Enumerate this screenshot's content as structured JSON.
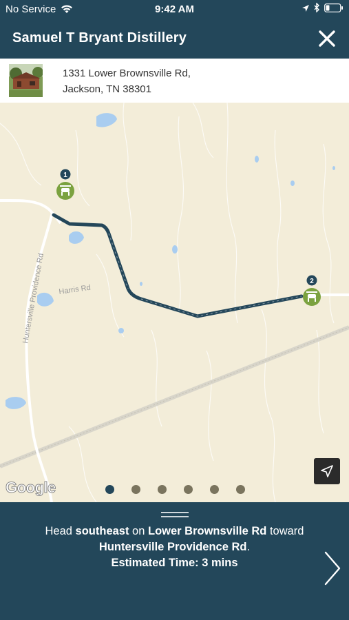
{
  "status": {
    "carrier": "No Service",
    "time": "9:42 AM"
  },
  "header": {
    "title": "Samuel T Bryant Distillery"
  },
  "address": {
    "line1": "1331 Lower Brownsville Rd,",
    "line2": "Jackson, TN 38301"
  },
  "map": {
    "markers": [
      {
        "number": "1"
      },
      {
        "number": "2"
      }
    ],
    "road_labels": {
      "hunterville": "Huntersville Providence Rd",
      "harris": "Harris Rd"
    },
    "attribution": "Google"
  },
  "pager": {
    "count": 6,
    "active_index": 0
  },
  "directions": {
    "part1": "Head ",
    "direction": "southeast",
    "part2": " on ",
    "road": "Lower Brownsville Rd",
    "part3": " toward",
    "destination": "Huntersville Providence Rd",
    "part4": ".",
    "estimated_time": "Estimated Time: 3 mins"
  },
  "colors": {
    "header": "#23475a",
    "map_bg": "#f3edd9",
    "route": "#24475a",
    "marker": "#7ba23f",
    "water": "#a9cdf0"
  }
}
